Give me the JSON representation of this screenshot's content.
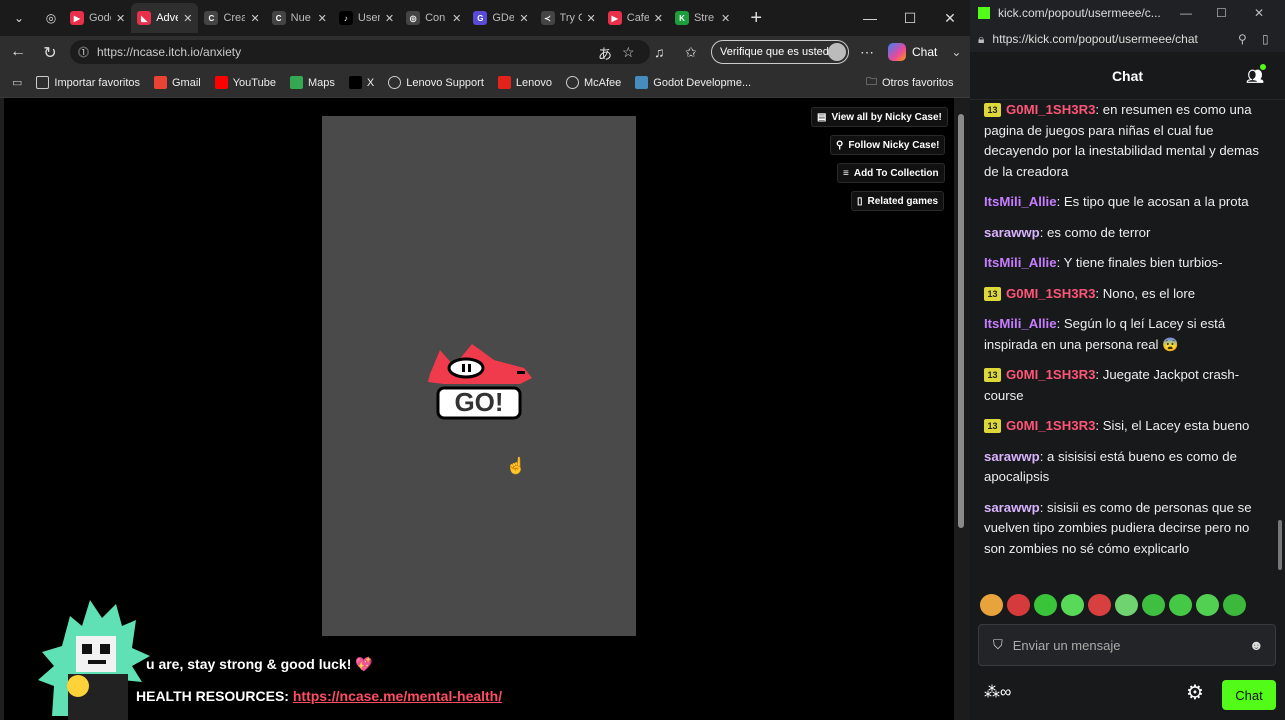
{
  "browser": {
    "tabs": [
      {
        "title": "Godo",
        "fav_color": "#e8304a",
        "fav": "▶"
      },
      {
        "title": "Adve",
        "fav_color": "#e8304a",
        "fav": "◣",
        "active": true
      },
      {
        "title": "Crea",
        "fav_color": "#444444",
        "fav": "C"
      },
      {
        "title": "Nue",
        "fav_color": "#444444",
        "fav": "C"
      },
      {
        "title": "User",
        "fav_color": "#000000",
        "fav": "♪"
      },
      {
        "title": "Con",
        "fav_color": "#444444",
        "fav": "◎"
      },
      {
        "title": "GDe",
        "fav_color": "#5a4bd6",
        "fav": "G"
      },
      {
        "title": "Try C",
        "fav_color": "#444444",
        "fav": "≺"
      },
      {
        "title": "Cafe",
        "fav_color": "#e8304a",
        "fav": "▶"
      },
      {
        "title": "Stre",
        "fav_color": "#1e9e3a",
        "fav": "K"
      }
    ],
    "url": "https://ncase.itch.io/anxiety",
    "verify_label": "Verifique que es usted",
    "chat_label": "Chat",
    "bookmarks": [
      {
        "label": "Importar favoritos",
        "icon": "import-icon",
        "color": "#cccccc"
      },
      {
        "label": "Gmail",
        "icon": "gmail-icon",
        "color": "#ea4335"
      },
      {
        "label": "YouTube",
        "icon": "youtube-icon",
        "color": "#ff0000"
      },
      {
        "label": "Maps",
        "icon": "maps-icon",
        "color": "#34a853"
      },
      {
        "label": "X",
        "icon": "x-icon",
        "color": "#000000"
      },
      {
        "label": "Lenovo Support",
        "icon": "globe-icon",
        "color": "#cccccc"
      },
      {
        "label": "Lenovo",
        "icon": "lenovo-icon",
        "color": "#e2231a"
      },
      {
        "label": "McAfee",
        "icon": "globe-icon",
        "color": "#cccccc"
      },
      {
        "label": "Godot Developme...",
        "icon": "godot-icon",
        "color": "#478cbf"
      }
    ],
    "other_favorites": "Otros favoritos"
  },
  "itch": {
    "view_all": "View all by Nicky Case!",
    "follow": "Follow Nicky Case!",
    "add_collection": "Add To Collection",
    "related": "Related games",
    "go_label": "GO!",
    "line1": "u are, stay strong & good luck! 💖",
    "line2_prefix": "HEALTH RESOURCES: ",
    "line2_link": "https://ncase.me/mental-health/"
  },
  "kick": {
    "window_title": "kick.com/popout/usermeee/c...",
    "address": "https://kick.com/popout/usermeee/chat",
    "header": "Chat",
    "messages": [
      {
        "badge": "13",
        "user": "G0MI_1SH3R3",
        "color": "#ff5577",
        "text": "en resumen es como una pagina de juegos para niñas el cual fue decayendo por la inestabilidad mental y demas de la creadora"
      },
      {
        "badge": "",
        "user": "ItsMili_Allie",
        "color": "#c77dff",
        "text": "Es tipo que le acosan a la prota"
      },
      {
        "badge": "",
        "user": "sarawwp",
        "color": "#d9b3ff",
        "text": "es como de terror"
      },
      {
        "badge": "",
        "user": "ItsMili_Allie",
        "color": "#c77dff",
        "text": "Y tiene finales bien turbios-"
      },
      {
        "badge": "13",
        "user": "G0MI_1SH3R3",
        "color": "#ff5577",
        "text": "Nono, es el lore"
      },
      {
        "badge": "",
        "user": "ItsMili_Allie",
        "color": "#c77dff",
        "text": "Según lo q leí Lacey si está inspirada en una persona real 😨"
      },
      {
        "badge": "13",
        "user": "G0MI_1SH3R3",
        "color": "#ff5577",
        "text": "Juegate Jackpot crash-course"
      },
      {
        "badge": "13",
        "user": "G0MI_1SH3R3",
        "color": "#ff5577",
        "text": "Sisi, el Lacey esta bueno"
      },
      {
        "badge": "",
        "user": "sarawwp",
        "color": "#d9b3ff",
        "text": "a sisisisi está bueno es como de apocalipsis"
      },
      {
        "badge": "",
        "user": "sarawwp",
        "color": "#d9b3ff",
        "text": "sisisii es como de personas que se vuelven tipo zombies pudiera decirse pero no son zombies no sé cómo explicarlo"
      }
    ],
    "emote_colors": [
      "#e8a33c",
      "#d63b3b",
      "#3ac43a",
      "#58d958",
      "#d84040",
      "#6fd46f",
      "#3fbf3f",
      "#45c845",
      "#52d052",
      "#3cb83c"
    ],
    "input_placeholder": "Enviar un mensaje",
    "chat_button": "Chat",
    "accent": "#53fc18"
  }
}
